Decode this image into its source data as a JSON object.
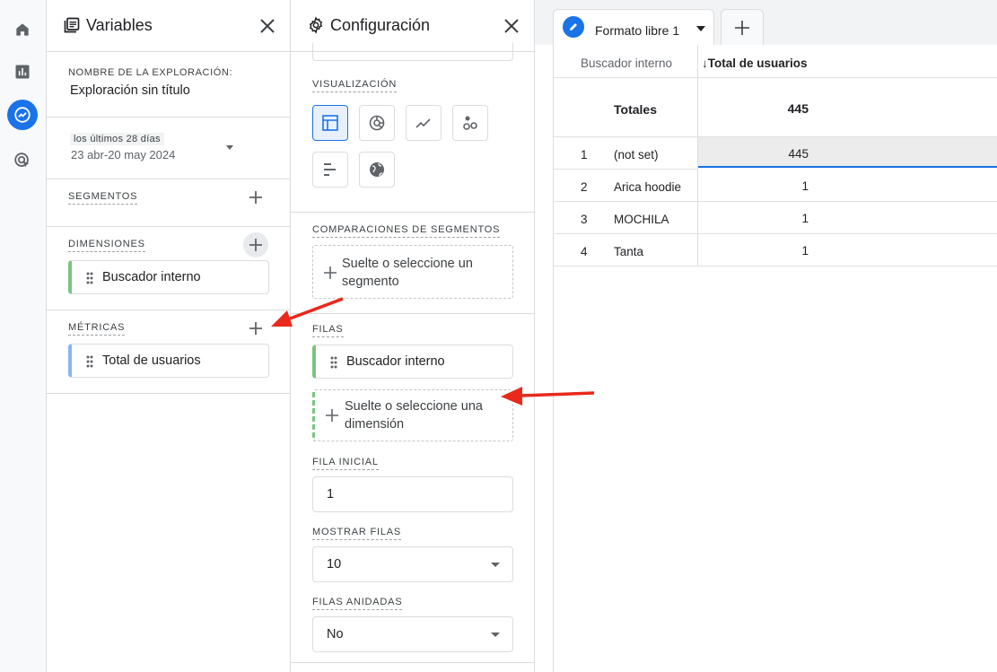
{
  "variables": {
    "title": "Variables",
    "exploration_name_label": "NOMBRE DE LA EXPLORACIÓN:",
    "exploration_name": "Exploración sin título",
    "date_badge": "los últimos 28 días",
    "date_range": "23 abr-20 may 2024",
    "segments_label": "SEGMENTOS",
    "dimensions_label": "DIMENSIONES",
    "dimension_chip": "Buscador interno",
    "metrics_label": "MÉTRICAS",
    "metric_chip": "Total de usuarios"
  },
  "config": {
    "title": "Configuración",
    "visualization_label": "VISUALIZACIÓN",
    "segment_comparisons_label": "COMPARACIONES DE SEGMENTOS",
    "segment_drop": "Suelte o seleccione un segmento",
    "rows_label": "FILAS",
    "row_chip": "Buscador interno",
    "row_drop": "Suelte o seleccione una dimensión",
    "start_row_label": "FILA INICIAL",
    "start_row_value": "1",
    "show_rows_label": "MOSTRAR FILAS",
    "show_rows_value": "10",
    "nested_rows_label": "FILAS ANIDADAS",
    "nested_rows_value": "No"
  },
  "canvas": {
    "tab_label": "Formato libre 1",
    "table": {
      "dimension_header": "Buscador interno",
      "metric_header": "↓Total de usuarios",
      "totals_label": "Totales",
      "totals_value": "445",
      "rows": [
        {
          "index": "1",
          "name": "(not set)",
          "value": "445"
        },
        {
          "index": "2",
          "name": "Arica hoodie",
          "value": "1"
        },
        {
          "index": "3",
          "name": "MOCHILA",
          "value": "1"
        },
        {
          "index": "4",
          "name": "Tanta",
          "value": "1"
        }
      ]
    }
  },
  "colors": {
    "accent": "#1a73e8",
    "annotation_arrow": "#e8291c",
    "dimension_green": "#7cc47f",
    "metric_blue": "#8ab4f8"
  }
}
